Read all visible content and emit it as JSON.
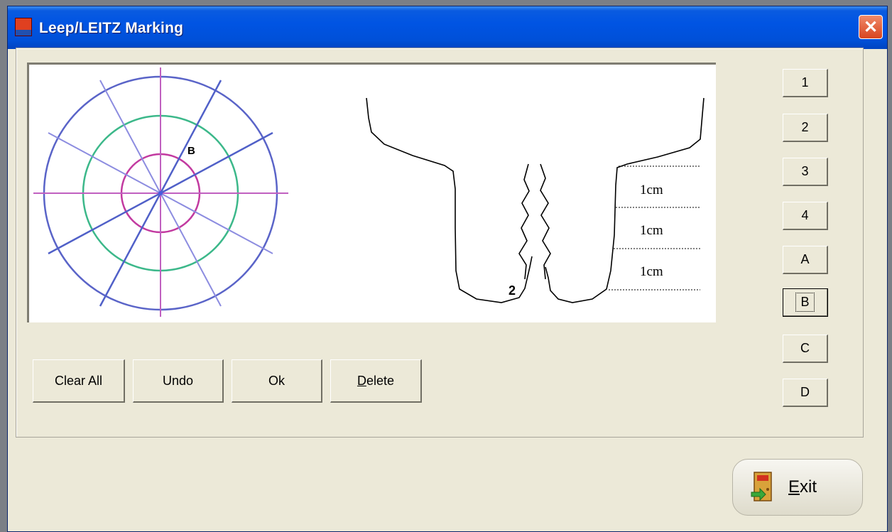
{
  "window": {
    "title": "Leep/LEITZ Marking",
    "close_glyph": "✕"
  },
  "diagram": {
    "clock_mark": "B",
    "cervix_mark": "2",
    "depth_labels": [
      "1cm",
      "1cm",
      "1cm"
    ]
  },
  "side_buttons": [
    "1",
    "2",
    "3",
    "4",
    "A",
    "B",
    "C",
    "D"
  ],
  "actions": {
    "clear_all": "Clear All",
    "undo": "Undo",
    "ok": "Ok",
    "delete_first": "D",
    "delete_rest": "elete"
  },
  "exit": {
    "first": "E",
    "rest": "xit"
  },
  "colors": {
    "titlebar": "#0054e3",
    "window_bg": "#ece9d8",
    "outer_ring": "#5a64c8",
    "middle_ring": "#3cb88a",
    "inner_ring": "#c23aa0",
    "axis": "#c060c0"
  }
}
